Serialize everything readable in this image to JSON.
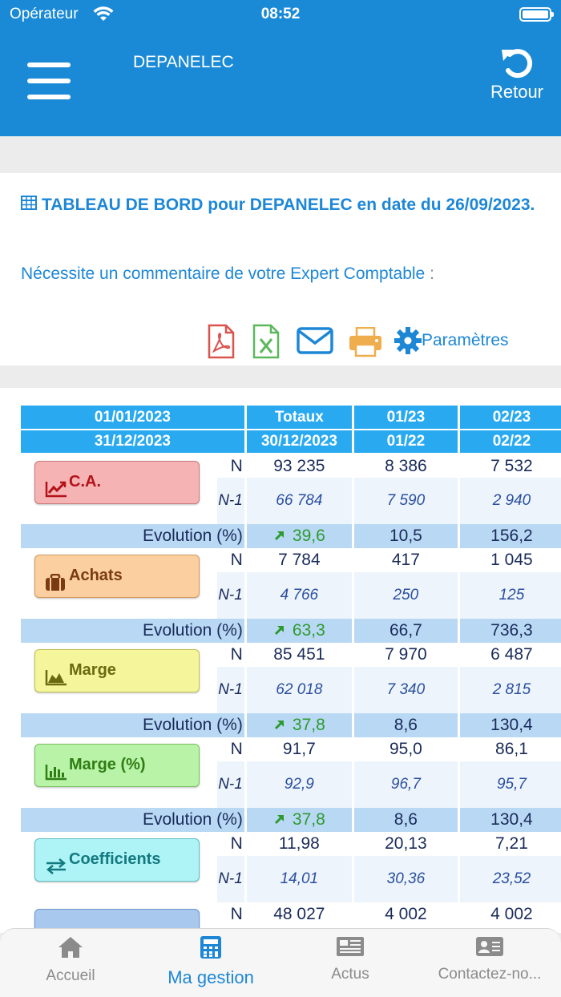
{
  "status": {
    "carrier": "Opérateur",
    "time": "08:52"
  },
  "header": {
    "title": "DEPANELEC",
    "back_label": "Retour"
  },
  "card": {
    "title": "TABLEAU DE BORD pour DEPANELEC en date du 26/09/2023.",
    "note": "Nécessite un commentaire de votre Expert Comptable",
    "note_colon": ":",
    "settings_label": "Paramètres"
  },
  "table": {
    "header1": [
      "01/01/2023",
      "Totaux",
      "01/23",
      "02/23"
    ],
    "header2": [
      "31/12/2023",
      "30/12/2023",
      "01/22",
      "02/22"
    ],
    "n_label": "N",
    "nm1_label": "N-1",
    "evolution_label": "Evolution (%)",
    "rows": [
      {
        "label": "C.A.",
        "n": [
          "93 235",
          "8 386",
          "7 532"
        ],
        "nm1": [
          "66 784",
          "7 590",
          "2 940"
        ],
        "evo": [
          "39,6",
          "10,5",
          "156,2"
        ],
        "color": "#f6b3b3",
        "border": "#c97b7b",
        "text_color": "#b3121b"
      },
      {
        "label": "Achats",
        "n": [
          "7 784",
          "417",
          "1 045"
        ],
        "nm1": [
          "4 766",
          "250",
          "125"
        ],
        "evo": [
          "63,3",
          "66,7",
          "736,3"
        ],
        "color": "#fbcfa0",
        "border": "#d39a5e",
        "text_color": "#7a3b10"
      },
      {
        "label": "Marge",
        "n": [
          "85 451",
          "7 970",
          "6 487"
        ],
        "nm1": [
          "62 018",
          "7 340",
          "2 815"
        ],
        "evo": [
          "37,8",
          "8,6",
          "130,4"
        ],
        "color": "#f5f69c",
        "border": "#c2c25a",
        "text_color": "#6a6a10"
      },
      {
        "label": "Marge (%)",
        "n": [
          "91,7",
          "95,0",
          "86,1"
        ],
        "nm1": [
          "92,9",
          "96,7",
          "95,7"
        ],
        "evo": [
          "37,8",
          "8,6",
          "130,4"
        ],
        "color": "#b9f3a7",
        "border": "#79c160",
        "text_color": "#2f7d14"
      },
      {
        "label": "Coefficients",
        "n": [
          "11,98",
          "20,13",
          "7,21"
        ],
        "nm1": [
          "14,01",
          "30,36",
          "23,52"
        ],
        "color": "#aef3f6",
        "border": "#62c0c4",
        "text_color": "#137a80"
      }
    ],
    "partial_row_n": [
      "48 027",
      "4 002",
      "4 002"
    ]
  },
  "tabs": [
    {
      "label": "Accueil",
      "icon": "home-icon"
    },
    {
      "label": "Ma gestion",
      "icon": "calculator-icon"
    },
    {
      "label": "Actus",
      "icon": "newspaper-icon"
    },
    {
      "label": "Contactez-no...",
      "icon": "contact-card-icon"
    }
  ]
}
